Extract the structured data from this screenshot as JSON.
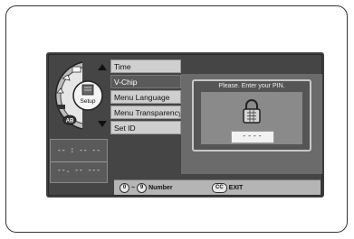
{
  "menu": {
    "category": "Setup",
    "items": [
      {
        "label": "Time"
      },
      {
        "label": "V-Chip"
      },
      {
        "label": "Menu Language"
      },
      {
        "label": "Menu Transparency"
      },
      {
        "label": "Set ID"
      }
    ],
    "active_index": 1
  },
  "wheel": {
    "badge": "AB"
  },
  "dialog": {
    "title": "Please. Enter your PIN.",
    "pin_value": "----"
  },
  "status": {
    "line1": "-- : -- --",
    "line2": "--. -- ---"
  },
  "footer": {
    "key_start": "0",
    "key_tilde": "~",
    "key_end": "9",
    "number_label": "Number",
    "cc_key": "CC",
    "exit_label": "EXIT"
  },
  "colors": {
    "screen_bg": "#454545",
    "menu_item_bg": "#cfcfcf",
    "active_item_bg": "#5a5a5a",
    "dialog_border": "#c8c8c8"
  }
}
